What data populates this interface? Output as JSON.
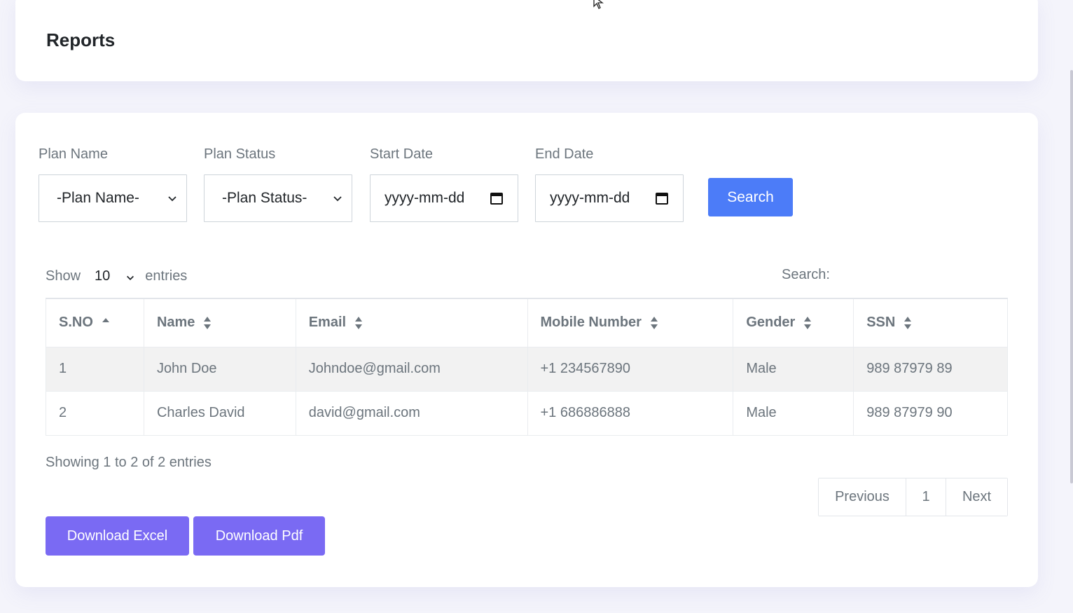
{
  "header": {
    "title": "Reports"
  },
  "filters": {
    "plan_name": {
      "label": "Plan Name",
      "value": "-Plan Name-"
    },
    "plan_status": {
      "label": "Plan Status",
      "value": "-Plan Status-"
    },
    "start_date": {
      "label": "Start Date",
      "placeholder": "yyyy-mm-dd"
    },
    "end_date": {
      "label": "End Date",
      "placeholder": "yyyy-mm-dd"
    },
    "search_button": "Search"
  },
  "table_controls": {
    "show_label": "Show",
    "entries_value": "10",
    "entries_label": "entries",
    "search_label": "Search:"
  },
  "table": {
    "columns": [
      "S.NO",
      "Name",
      "Email",
      "Mobile Number",
      "Gender",
      "SSN"
    ],
    "rows": [
      [
        "1",
        "John Doe",
        "Johndoe@gmail.com",
        "+1 234567890",
        "Male",
        "989 87979 89"
      ],
      [
        "2",
        "Charles David",
        "david@gmail.com",
        "+1 686886888",
        "Male",
        "989 87979 90"
      ]
    ]
  },
  "info": "Showing 1 to 2 of 2 entries",
  "pagination": {
    "previous": "Previous",
    "page": "1",
    "next": "Next"
  },
  "actions": {
    "download_excel": "Download Excel",
    "download_pdf": "Download Pdf"
  },
  "colors": {
    "search_button": "#4c7cf8",
    "download_button": "#7a6af3",
    "background": "#f4f4fb"
  },
  "icons": {
    "select": "chevron-down-icon",
    "date": "calendar-icon",
    "sort": "sort-icon",
    "sort_active": "sort-asc-icon"
  }
}
